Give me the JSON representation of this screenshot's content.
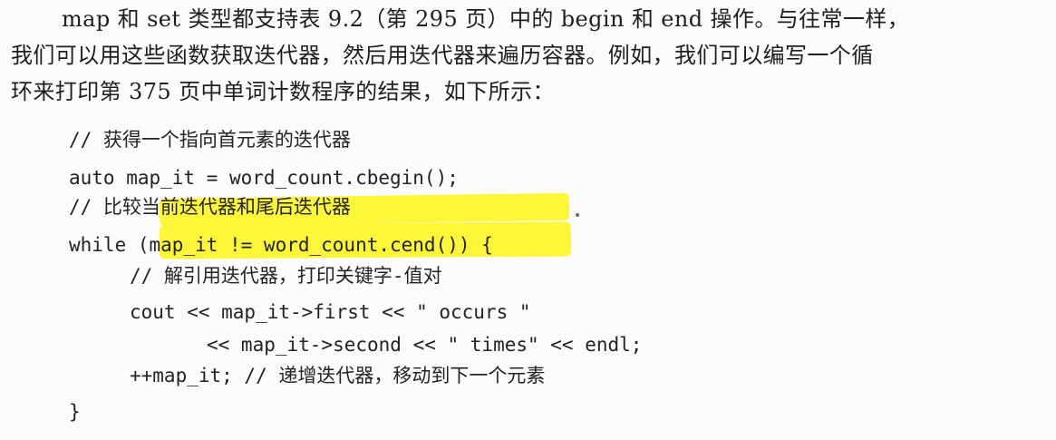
{
  "paragraph": {
    "line1": "map 和 set 类型都支持表 9.2（第 295 页）中的 begin 和 end 操作。与往常一样，",
    "line2": "我们可以用这些函数获取迭代器，然后用迭代器来遍历容器。例如，我们可以编写一个循",
    "line3": "环来打印第 375 页中单词计数程序的结果，如下所示："
  },
  "code": {
    "line1": "// 获得一个指向首元素的迭代器",
    "line2": "auto map_it = word_count.cbegin();",
    "line3": "// 比较当前迭代器和尾后迭代器",
    "line4": "while (map_it != word_count.cend()) {",
    "line5": "// 解引用迭代器，打印关键字-值对",
    "line6": "cout << map_it->first << \" occurs \"",
    "line7": "<< map_it->second << \" times\" << endl;",
    "line8": "++map_it; // 递增迭代器，移动到下一个元素",
    "line9": "}"
  },
  "colors": {
    "highlight": "#fbf52d",
    "text": "#1f1f1f",
    "background": "#fbfbfa"
  }
}
